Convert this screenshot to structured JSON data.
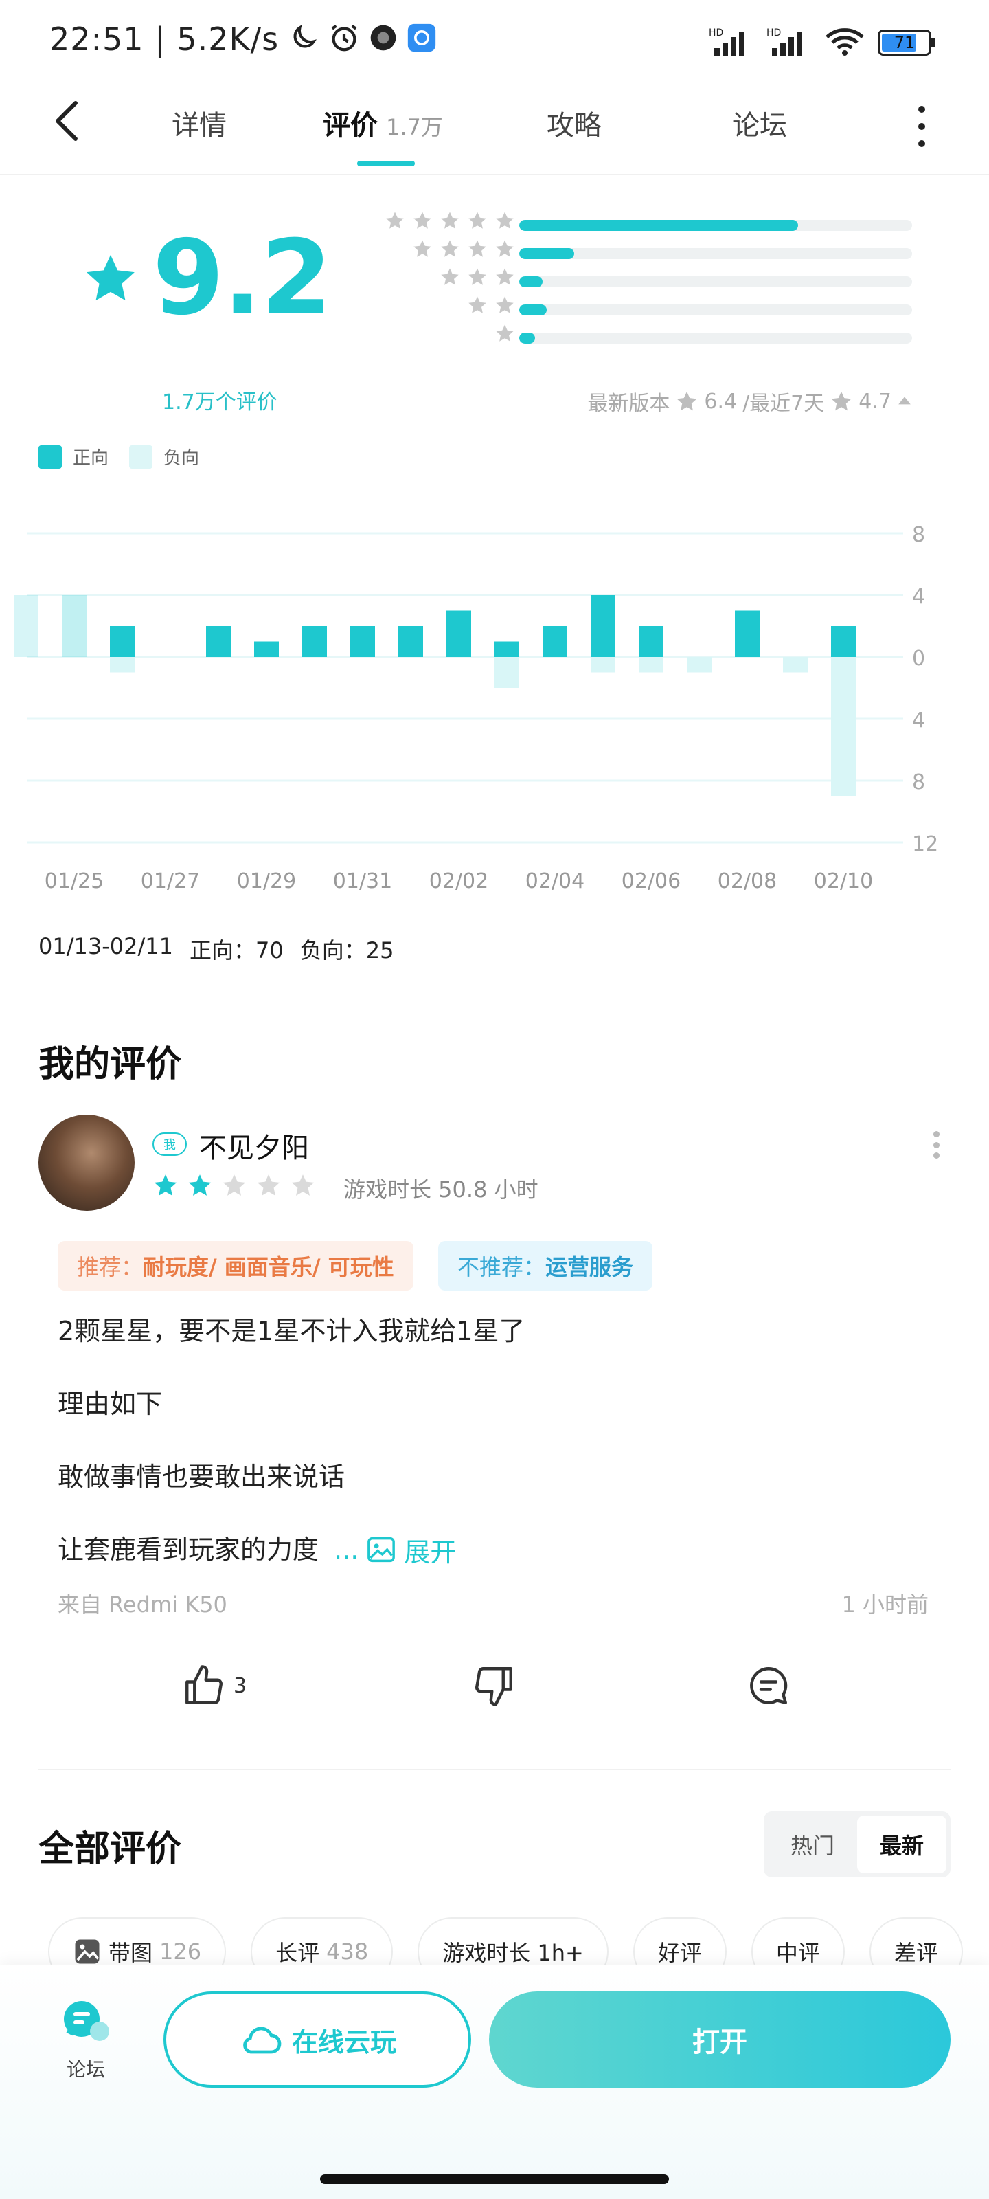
{
  "status_bar": {
    "time": "22:51 | 5.2K/s",
    "battery": "71"
  },
  "nav": {
    "tabs": [
      {
        "label": "详情"
      },
      {
        "label": "评价",
        "count": "1.7万"
      },
      {
        "label": "攻略"
      },
      {
        "label": "论坛"
      }
    ]
  },
  "rating": {
    "score": "9.2",
    "count_label": "1.7万个评价",
    "distribution": [
      0.71,
      0.14,
      0.06,
      0.07,
      0.04
    ],
    "latest_version_label": "最新版本",
    "latest_version_score": "6.4",
    "recent_label": "/最近7天",
    "recent_score": "4.7"
  },
  "legend": {
    "positive": "正向",
    "negative": "负向"
  },
  "colors": {
    "accent": "#1ec8cf",
    "negative_bar": "#d9f6f7",
    "orange": "#e97a44",
    "blue": "#2a9dce"
  },
  "chart_data": {
    "type": "bar",
    "categories": [
      "01/24",
      "01/25",
      "01/26",
      "01/27",
      "01/28",
      "01/29",
      "01/30",
      "01/31",
      "02/01",
      "02/02",
      "02/03",
      "02/04",
      "02/05",
      "02/06",
      "02/07",
      "02/08",
      "02/09",
      "02/10",
      "02/11"
    ],
    "x_tick_labels": [
      "01/25",
      "01/27",
      "01/29",
      "01/31",
      "02/02",
      "02/04",
      "02/06",
      "02/08",
      "02/10"
    ],
    "series": [
      {
        "name": "正向",
        "values": [
          4,
          4,
          2,
          0,
          2,
          1,
          2,
          2,
          2,
          3,
          1,
          2,
          4,
          2,
          0,
          3,
          0,
          2,
          0
        ]
      },
      {
        "name": "负向",
        "values": [
          0,
          0,
          1,
          0,
          0,
          0,
          0,
          0,
          0,
          0,
          2,
          0,
          1,
          1,
          1,
          0,
          1,
          9,
          0
        ]
      }
    ],
    "y_tick_labels": [
      "8",
      "4",
      "0",
      "4",
      "8",
      "12"
    ],
    "ylim": [
      -12,
      8
    ],
    "grid": true
  },
  "period": {
    "range": "01/13-02/11",
    "positive": "正向：70",
    "negative": "负向：25"
  },
  "my_review": {
    "title": "我的评价",
    "me_badge": "我",
    "username": "不见夕阳",
    "stars": 2,
    "playtime": "游戏时长 50.8 小时",
    "recommend_prefix": "推荐：",
    "recommend_items": "耐玩度/ 画面音乐/ 可玩性",
    "not_recommend_prefix": "不推荐：",
    "not_recommend_items": "运营服务",
    "lines": [
      "2颗星星，要不是1星不计入我就给1星了",
      "理由如下",
      "敢做事情也要敢出来说话",
      "让套鹿看到玩家的力度"
    ],
    "ellipsis": "...",
    "expand_label": "展开",
    "device": "来自 Redmi K50",
    "time_ago": "1 小时前",
    "like_count": "3"
  },
  "all_reviews": {
    "title": "全部评价",
    "sort": [
      "热门",
      "最新"
    ],
    "filters": [
      {
        "label": "带图",
        "count": "126"
      },
      {
        "label": "长评",
        "count": "438"
      },
      {
        "label": "游戏时长 1h+",
        "count": ""
      },
      {
        "label": "好评",
        "count": ""
      },
      {
        "label": "中评",
        "count": ""
      },
      {
        "label": "差评",
        "count": ""
      }
    ]
  },
  "bottom_bar": {
    "forum_label": "论坛",
    "cloud_play_label": "在线云玩",
    "open_label": "打开"
  }
}
